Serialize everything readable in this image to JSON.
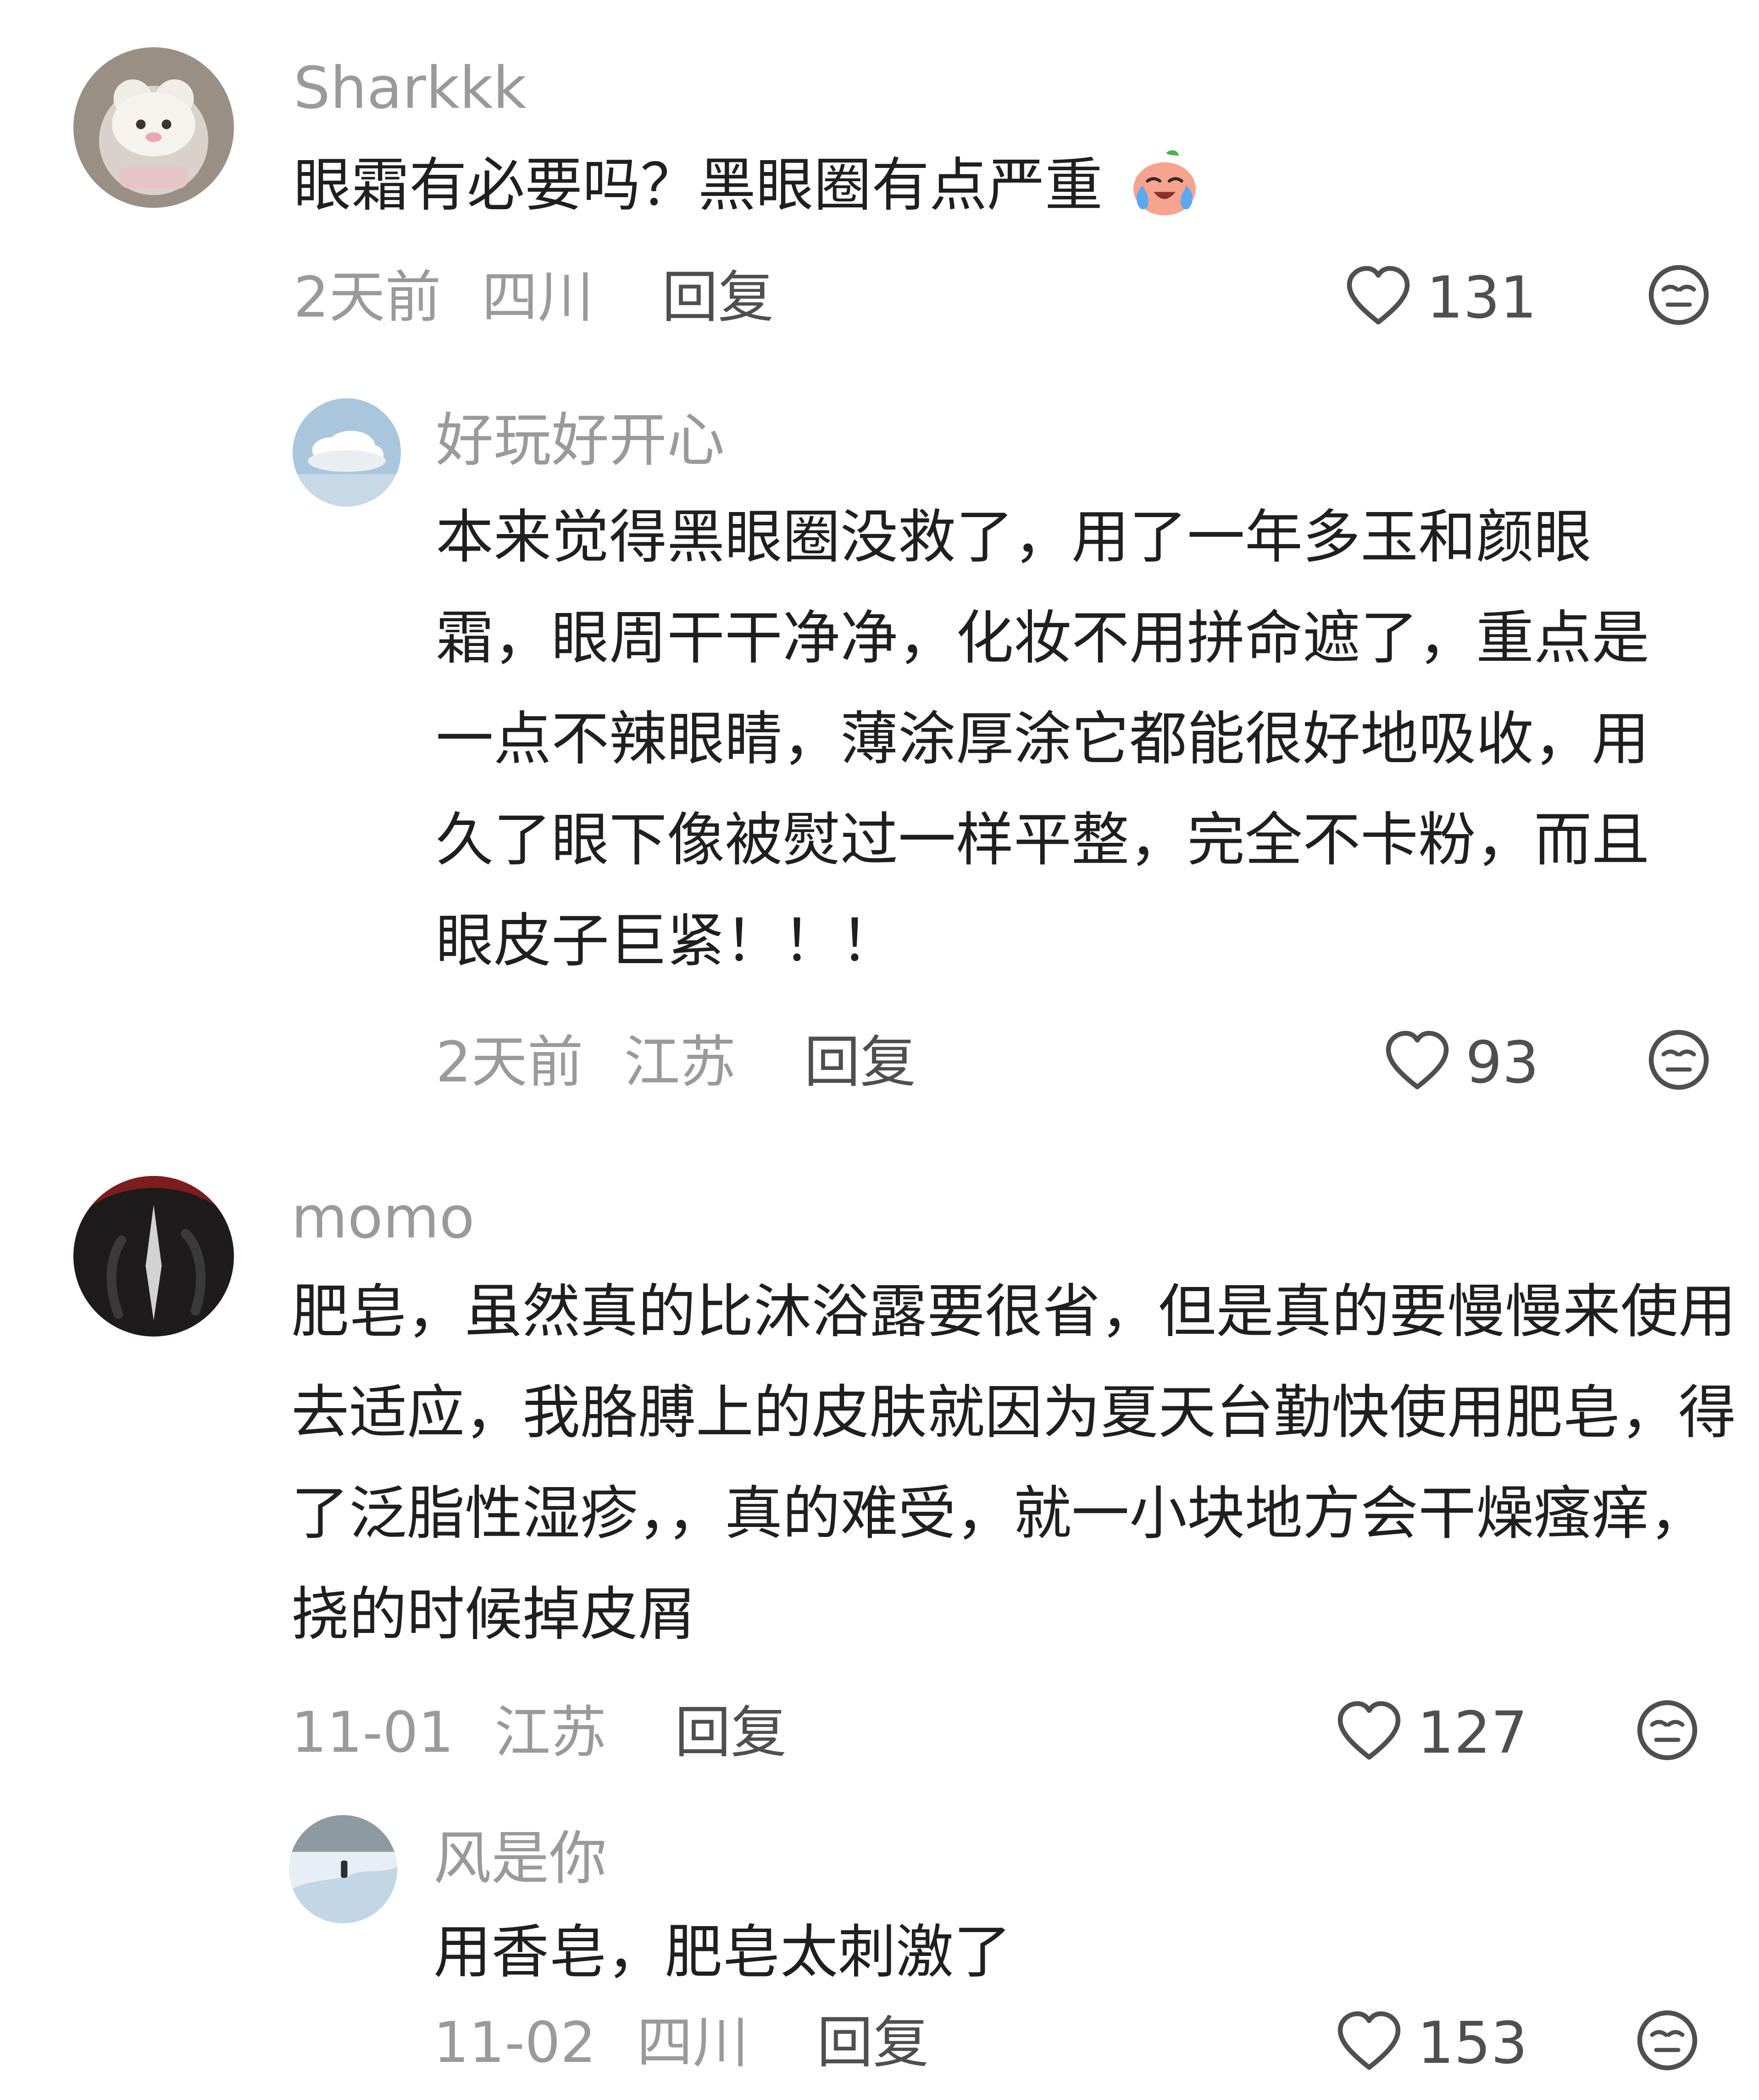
{
  "comments": [
    {
      "username": "Sharkkk",
      "text": "眼霜有必要吗？黑眼圈有点严重",
      "emoji": "crying-laughing-face-icon",
      "time": "2天前",
      "location": "四川",
      "reply_label": "回复",
      "likes": "131",
      "replies": [
        {
          "username": "好玩好开心",
          "text": "本来觉得黑眼圈没救了，用了一年多玉和颜眼霜，眼周干干净净，化妆不用拼命遮了，重点是一点不辣眼睛，薄涂厚涂它都能很好地吸收，用久了眼下像被熨过一样平整，完全不卡粉，而且眼皮子巨紧！！！",
          "time": "2天前",
          "location": "江苏",
          "reply_label": "回复",
          "likes": "93"
        }
      ]
    },
    {
      "username": "momo",
      "text": "肥皂，虽然真的比沐浴露要很省，但是真的要慢慢来使用去适应，我胳膊上的皮肤就因为夏天台勤快使用肥皂，得了泛脂性湿疹，，真的难受，就一小块地方会干燥瘙痒，挠的时候掉皮屑",
      "time": "11-01",
      "location": "江苏",
      "reply_label": "回复",
      "likes": "127",
      "replies": [
        {
          "username": "风是你",
          "text": "用香皂，肥皂太刺激了",
          "time": "11-02",
          "location": "四川",
          "reply_label": "回复",
          "likes": "153"
        }
      ]
    }
  ],
  "icons": {
    "like": "heart-outline-icon",
    "dislike": "neutral-face-icon"
  },
  "colors": {
    "text": "#1f1f1f",
    "meta": "#9a9a9a",
    "action": "#4f4f4f"
  }
}
